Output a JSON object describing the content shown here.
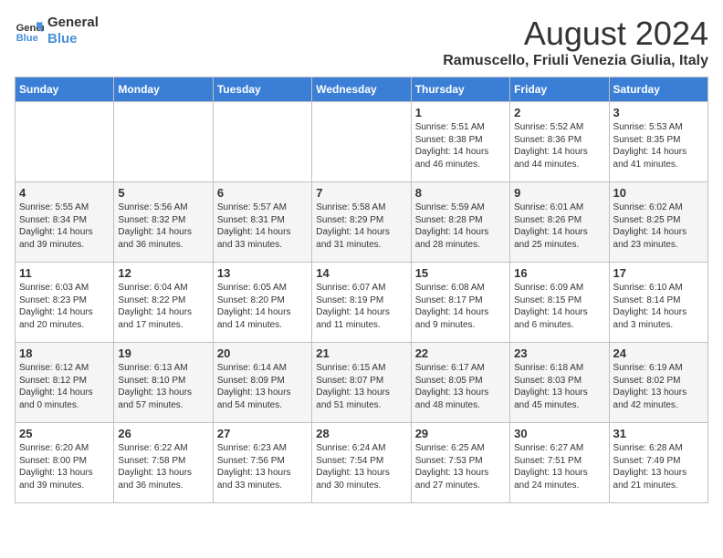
{
  "logo": {
    "line1": "General",
    "line2": "Blue"
  },
  "title": "August 2024",
  "location": "Ramuscello, Friuli Venezia Giulia, Italy",
  "weekdays": [
    "Sunday",
    "Monday",
    "Tuesday",
    "Wednesday",
    "Thursday",
    "Friday",
    "Saturday"
  ],
  "weeks": [
    [
      {
        "day": "",
        "content": ""
      },
      {
        "day": "",
        "content": ""
      },
      {
        "day": "",
        "content": ""
      },
      {
        "day": "",
        "content": ""
      },
      {
        "day": "1",
        "content": "Sunrise: 5:51 AM\nSunset: 8:38 PM\nDaylight: 14 hours and 46 minutes."
      },
      {
        "day": "2",
        "content": "Sunrise: 5:52 AM\nSunset: 8:36 PM\nDaylight: 14 hours and 44 minutes."
      },
      {
        "day": "3",
        "content": "Sunrise: 5:53 AM\nSunset: 8:35 PM\nDaylight: 14 hours and 41 minutes."
      }
    ],
    [
      {
        "day": "4",
        "content": "Sunrise: 5:55 AM\nSunset: 8:34 PM\nDaylight: 14 hours and 39 minutes."
      },
      {
        "day": "5",
        "content": "Sunrise: 5:56 AM\nSunset: 8:32 PM\nDaylight: 14 hours and 36 minutes."
      },
      {
        "day": "6",
        "content": "Sunrise: 5:57 AM\nSunset: 8:31 PM\nDaylight: 14 hours and 33 minutes."
      },
      {
        "day": "7",
        "content": "Sunrise: 5:58 AM\nSunset: 8:29 PM\nDaylight: 14 hours and 31 minutes."
      },
      {
        "day": "8",
        "content": "Sunrise: 5:59 AM\nSunset: 8:28 PM\nDaylight: 14 hours and 28 minutes."
      },
      {
        "day": "9",
        "content": "Sunrise: 6:01 AM\nSunset: 8:26 PM\nDaylight: 14 hours and 25 minutes."
      },
      {
        "day": "10",
        "content": "Sunrise: 6:02 AM\nSunset: 8:25 PM\nDaylight: 14 hours and 23 minutes."
      }
    ],
    [
      {
        "day": "11",
        "content": "Sunrise: 6:03 AM\nSunset: 8:23 PM\nDaylight: 14 hours and 20 minutes."
      },
      {
        "day": "12",
        "content": "Sunrise: 6:04 AM\nSunset: 8:22 PM\nDaylight: 14 hours and 17 minutes."
      },
      {
        "day": "13",
        "content": "Sunrise: 6:05 AM\nSunset: 8:20 PM\nDaylight: 14 hours and 14 minutes."
      },
      {
        "day": "14",
        "content": "Sunrise: 6:07 AM\nSunset: 8:19 PM\nDaylight: 14 hours and 11 minutes."
      },
      {
        "day": "15",
        "content": "Sunrise: 6:08 AM\nSunset: 8:17 PM\nDaylight: 14 hours and 9 minutes."
      },
      {
        "day": "16",
        "content": "Sunrise: 6:09 AM\nSunset: 8:15 PM\nDaylight: 14 hours and 6 minutes."
      },
      {
        "day": "17",
        "content": "Sunrise: 6:10 AM\nSunset: 8:14 PM\nDaylight: 14 hours and 3 minutes."
      }
    ],
    [
      {
        "day": "18",
        "content": "Sunrise: 6:12 AM\nSunset: 8:12 PM\nDaylight: 14 hours and 0 minutes."
      },
      {
        "day": "19",
        "content": "Sunrise: 6:13 AM\nSunset: 8:10 PM\nDaylight: 13 hours and 57 minutes."
      },
      {
        "day": "20",
        "content": "Sunrise: 6:14 AM\nSunset: 8:09 PM\nDaylight: 13 hours and 54 minutes."
      },
      {
        "day": "21",
        "content": "Sunrise: 6:15 AM\nSunset: 8:07 PM\nDaylight: 13 hours and 51 minutes."
      },
      {
        "day": "22",
        "content": "Sunrise: 6:17 AM\nSunset: 8:05 PM\nDaylight: 13 hours and 48 minutes."
      },
      {
        "day": "23",
        "content": "Sunrise: 6:18 AM\nSunset: 8:03 PM\nDaylight: 13 hours and 45 minutes."
      },
      {
        "day": "24",
        "content": "Sunrise: 6:19 AM\nSunset: 8:02 PM\nDaylight: 13 hours and 42 minutes."
      }
    ],
    [
      {
        "day": "25",
        "content": "Sunrise: 6:20 AM\nSunset: 8:00 PM\nDaylight: 13 hours and 39 minutes."
      },
      {
        "day": "26",
        "content": "Sunrise: 6:22 AM\nSunset: 7:58 PM\nDaylight: 13 hours and 36 minutes."
      },
      {
        "day": "27",
        "content": "Sunrise: 6:23 AM\nSunset: 7:56 PM\nDaylight: 13 hours and 33 minutes."
      },
      {
        "day": "28",
        "content": "Sunrise: 6:24 AM\nSunset: 7:54 PM\nDaylight: 13 hours and 30 minutes."
      },
      {
        "day": "29",
        "content": "Sunrise: 6:25 AM\nSunset: 7:53 PM\nDaylight: 13 hours and 27 minutes."
      },
      {
        "day": "30",
        "content": "Sunrise: 6:27 AM\nSunset: 7:51 PM\nDaylight: 13 hours and 24 minutes."
      },
      {
        "day": "31",
        "content": "Sunrise: 6:28 AM\nSunset: 7:49 PM\nDaylight: 13 hours and 21 minutes."
      }
    ]
  ]
}
